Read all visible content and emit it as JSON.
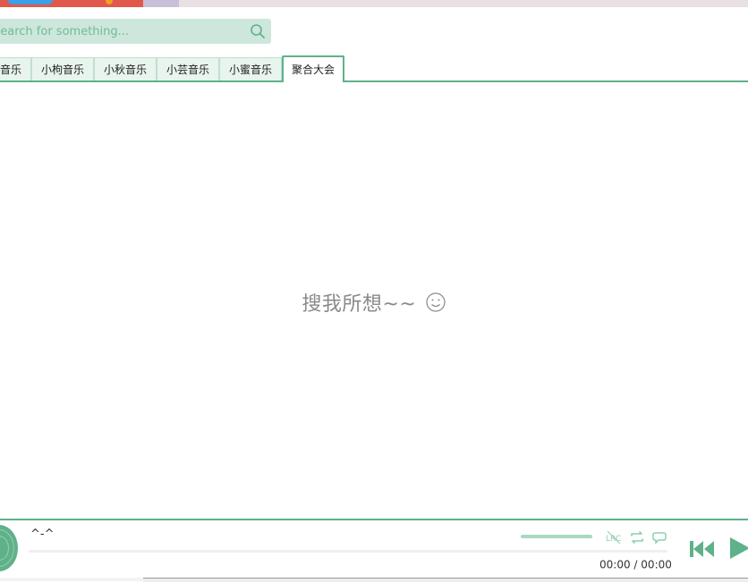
{
  "search": {
    "placeholder": "Search for something..."
  },
  "tabs": [
    {
      "label": "小企音乐"
    },
    {
      "label": "小枸音乐"
    },
    {
      "label": "小秋音乐"
    },
    {
      "label": "小芸音乐"
    },
    {
      "label": "小蜜音乐"
    },
    {
      "label": "聚合大会",
      "active": true
    }
  ],
  "main": {
    "empty_message": "搜我所想~~"
  },
  "player": {
    "song_title": "^-^",
    "current_time": "00:00",
    "separator": "/",
    "total_time": "00:00",
    "progress": 0,
    "volume": 1.0,
    "lrc_label": "LRC"
  },
  "colors": {
    "accent": "#5fb18a",
    "search_bg": "#cde7dc",
    "tab_bg": "#e8f4ee",
    "message": "#8a8a8a"
  }
}
